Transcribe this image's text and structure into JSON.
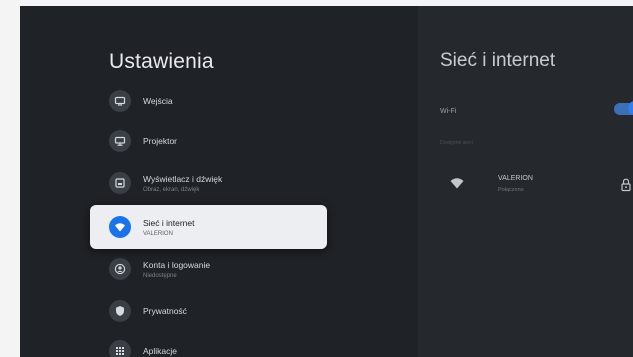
{
  "settings": {
    "title": "Ustawienia",
    "items": [
      {
        "label": "Wejścia",
        "sub": "",
        "icon": "input-icon"
      },
      {
        "label": "Projektor",
        "sub": "",
        "icon": "projector-icon"
      },
      {
        "label": "Wyświetlacz i dźwięk",
        "sub": "Obraz, ekran, dźwięk",
        "icon": "display-icon"
      },
      {
        "label": "Sieć i internet",
        "sub": "VALERION",
        "icon": "wifi-icon"
      },
      {
        "label": "Konta i logowanie",
        "sub": "Niedostępne",
        "icon": "account-icon"
      },
      {
        "label": "Prywatność",
        "sub": "",
        "icon": "privacy-shield-icon"
      },
      {
        "label": "Aplikacje",
        "sub": "",
        "icon": "apps-grid-icon"
      }
    ]
  },
  "network": {
    "title": "Sieć i internet",
    "wifi_label": "Wi-Fi",
    "wifi_enabled": true,
    "section_label": "Dostępne sieci",
    "network_name": "VALERION",
    "network_status": "Połączono"
  },
  "colors": {
    "accent": "#1a73e8",
    "background": "#1f2226",
    "panel": "#25292e"
  }
}
